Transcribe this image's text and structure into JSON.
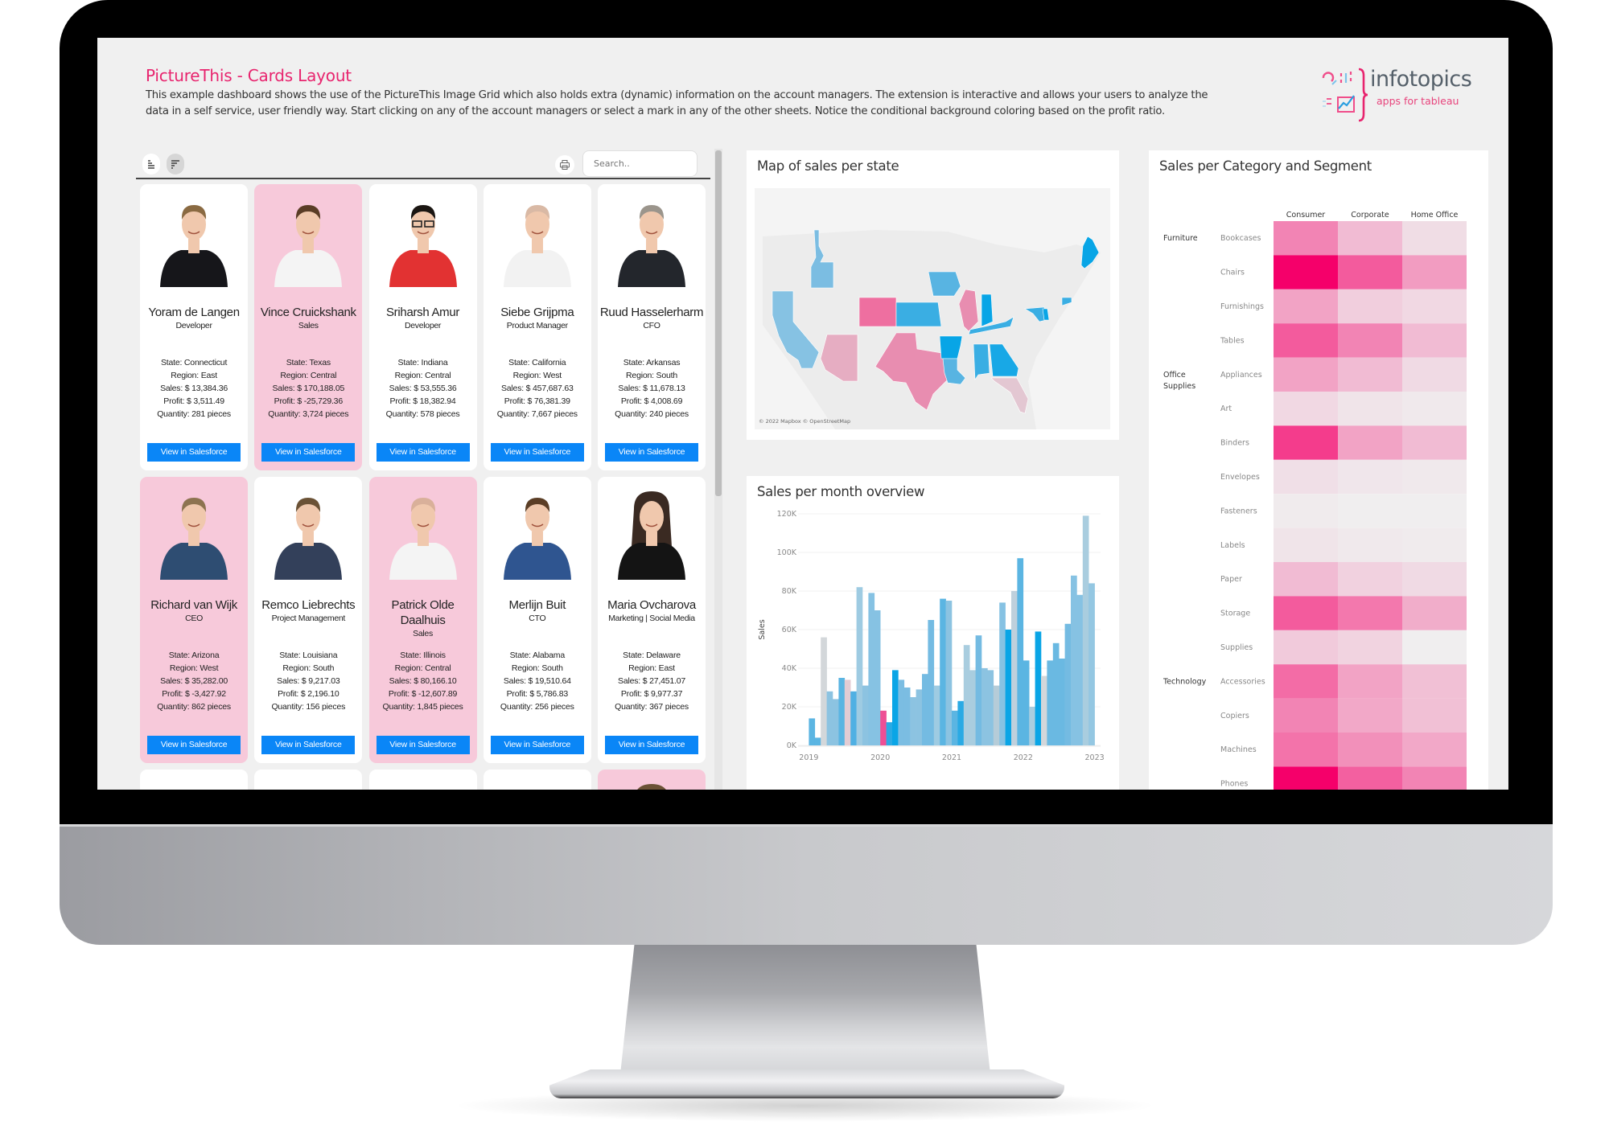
{
  "dashboard": {
    "title": "PictureThis - Cards Layout",
    "description": "This example dashboard shows the use of the PictureThis Image Grid which also holds extra (dynamic) information on the account managers. The extension is interactive and allows your users to analyze the data in a self service, user friendly way. Start clicking on any of the account managers or select a mark in any of the other sheets. Notice the conditional background coloring based on the profit ratio.",
    "accent_color": "#e8246e",
    "logo": {
      "name": "infotopics",
      "tagline": "apps for tableau"
    }
  },
  "image_grid": {
    "toolbar": {
      "sort_asc_icon": "sort-list-icon",
      "sort_desc_icon": "sort-descending-icon",
      "print_icon": "printer-icon",
      "search_placeholder": "Search.."
    },
    "button_label": "View in Salesforce",
    "button_color": "#0a86f7",
    "highlight_color": "#f7c9da",
    "cards": [
      {
        "name": "Yoram de Langen",
        "role": "Developer",
        "state": "State: Connecticut",
        "region": "Region: East",
        "sales": "Sales: $ 13,384.36",
        "profit": "Profit: $ 3,511.49",
        "quantity": "Quantity: 281 pieces",
        "highlight": false,
        "photo": {
          "shirt": "#16161a",
          "hair": "#8a6a42",
          "bg": "none"
        }
      },
      {
        "name": "Vince Cruickshank",
        "role": "Sales",
        "state": "State: Texas",
        "region": "Region: Central",
        "sales": "Sales: $ 170,188.05",
        "profit": "Profit: $ -25,729.36",
        "quantity": "Quantity: 3,724 pieces",
        "highlight": true,
        "photo": {
          "shirt": "#f4f4f4",
          "hair": "#5a3d26"
        }
      },
      {
        "name": "Sriharsh Amur",
        "role": "Developer",
        "state": "State: Indiana",
        "region": "Region: Central",
        "sales": "Sales: $ 53,555.36",
        "profit": "Profit: $ 18,382.94",
        "quantity": "Quantity: 578 pieces",
        "highlight": false,
        "photo": {
          "shirt": "#e23232",
          "hair": "#1b1612"
        }
      },
      {
        "name": "Siebe Grijpma",
        "role": "Product Manager",
        "state": "State: California",
        "region": "Region: West",
        "sales": "Sales: $ 457,687.63",
        "profit": "Profit: $ 76,381.39",
        "quantity": "Quantity: 7,667 pieces",
        "highlight": false,
        "photo": {
          "shirt": "#f2f2f2",
          "hair": "#d9b9a5"
        }
      },
      {
        "name": "Ruud Hasselerharm",
        "role": "CFO",
        "state": "State: Arkansas",
        "region": "Region: South",
        "sales": "Sales: $ 11,678.13",
        "profit": "Profit: $ 4,008.69",
        "quantity": "Quantity: 240 pieces",
        "highlight": false,
        "photo": {
          "shirt": "#23262c",
          "hair": "#9b958c"
        }
      },
      {
        "name": "Richard van Wijk",
        "role": "CEO",
        "state": "State: Arizona",
        "region": "Region: West",
        "sales": "Sales: $ 35,282.00",
        "profit": "Profit: $ -3,427.92",
        "quantity": "Quantity: 862 pieces",
        "highlight": true,
        "photo": {
          "shirt": "#2e4d72",
          "hair": "#8d7350"
        }
      },
      {
        "name": "Remco Liebrechts",
        "role": "Project Management",
        "state": "State: Louisiana",
        "region": "Region: South",
        "sales": "Sales: $ 9,217.03",
        "profit": "Profit: $ 2,196.10",
        "quantity": "Quantity: 156 pieces",
        "highlight": false,
        "photo": {
          "shirt": "#33405a",
          "hair": "#6b5236"
        }
      },
      {
        "name": "Patrick Olde Daalhuis",
        "role": "Sales",
        "state": "State: Illinois",
        "region": "Region: Central",
        "sales": "Sales: $ 80,166.10",
        "profit": "Profit: $ -12,607.89",
        "quantity": "Quantity: 1,845 pieces",
        "highlight": true,
        "photo": {
          "shirt": "#f4f4f4",
          "hair": "#d9b09a"
        }
      },
      {
        "name": "Merlijn Buit",
        "role": "CTO",
        "state": "State: Alabama",
        "region": "Region: South",
        "sales": "Sales: $ 19,510.64",
        "profit": "Profit: $ 5,786.83",
        "quantity": "Quantity: 256 pieces",
        "highlight": false,
        "photo": {
          "shirt": "#2f5590",
          "hair": "#5b3e26"
        }
      },
      {
        "name": "Maria Ovcharova",
        "role": "Marketing | Social Media",
        "state": "State: Delaware",
        "region": "Region: East",
        "sales": "Sales: $ 27,451.07",
        "profit": "Profit: $ 9,977.37",
        "quantity": "Quantity: 367 pieces",
        "highlight": false,
        "photo": {
          "shirt": "#141414",
          "hair": "#3a2a22"
        }
      }
    ],
    "partial_row_highlight": [
      false,
      false,
      false,
      false,
      true
    ]
  },
  "map_sheet": {
    "title": "Map of sales per state",
    "attribution": "© 2022 Mapbox © OpenStreetMap",
    "states": [
      {
        "state": "Idaho",
        "color": "#7bbde2"
      },
      {
        "state": "California",
        "color": "#86c2e3"
      },
      {
        "state": "Arizona",
        "color": "#e6adc2"
      },
      {
        "state": "Colorado",
        "color": "#ee6fa0"
      },
      {
        "state": "Texas",
        "color": "#e88db0"
      },
      {
        "state": "Kansas",
        "color": "#3aaee3"
      },
      {
        "state": "Iowa",
        "color": "#58b4e2"
      },
      {
        "state": "Illinois",
        "color": "#e88db0"
      },
      {
        "state": "Indiana",
        "color": "#08a5e6"
      },
      {
        "state": "Kentucky",
        "color": "#3aaee3"
      },
      {
        "state": "Arkansas",
        "color": "#08a5e6"
      },
      {
        "state": "Louisiana",
        "color": "#58b4e2"
      },
      {
        "state": "Alabama",
        "color": "#3aaee3"
      },
      {
        "state": "Georgia",
        "color": "#18a8e6"
      },
      {
        "state": "Florida",
        "color": "#e3c7d2"
      },
      {
        "state": "Maryland",
        "color": "#3aaee3"
      },
      {
        "state": "Delaware",
        "color": "#08a5e6"
      },
      {
        "state": "Connecticut",
        "color": "#3aaee3"
      },
      {
        "state": "Maine",
        "color": "#08a5e6"
      }
    ]
  },
  "chart_data": [
    {
      "type": "bar",
      "title": "Sales per month overview",
      "xlabel": "",
      "ylabel": "Sales",
      "ylim": [
        0,
        120000
      ],
      "yticks": [
        "0K",
        "20K",
        "40K",
        "60K",
        "80K",
        "100K",
        "120K"
      ],
      "ytick_values": [
        0,
        20000,
        40000,
        60000,
        80000,
        100000,
        120000
      ],
      "xticks": [
        "2019",
        "2020",
        "2021",
        "2022",
        "2023"
      ],
      "grid": true,
      "x_start": "2019-01",
      "values": [
        14000,
        4000,
        56000,
        28000,
        24000,
        35000,
        34000,
        28000,
        82000,
        31000,
        79000,
        70000,
        18000,
        12000,
        39000,
        34000,
        30000,
        25000,
        29000,
        37000,
        65000,
        31000,
        76000,
        75000,
        18000,
        23000,
        52000,
        39000,
        57000,
        40000,
        39000,
        31000,
        74000,
        60000,
        80000,
        97000,
        44000,
        20000,
        59000,
        36000,
        44000,
        53000,
        45000,
        63000,
        88000,
        78000,
        119000,
        84000
      ],
      "colors": [
        "#5bb5e2",
        "#5bb5e2",
        "#d3d7da",
        "#8cc3e1",
        "#8cc3e1",
        "#5bb5e2",
        "#e3ccd3",
        "#4fb0e3",
        "#9ecbe2",
        "#8cc3e1",
        "#86c2e3",
        "#86c2e3",
        "#ee4f95",
        "#2aaae4",
        "#0aa5e6",
        "#7bbde2",
        "#7bbde2",
        "#8cc3e1",
        "#8cc3e1",
        "#74bbe2",
        "#74bbe2",
        "#9ecbe2",
        "#5bb5e2",
        "#8cc3e1",
        "#5bb5e2",
        "#2aaae4",
        "#a9cddf",
        "#a9cddf",
        "#74bbe2",
        "#8cc3e1",
        "#8cc3e1",
        "#b5ccd8",
        "#86c2e3",
        "#0aa5e6",
        "#bfd0dc",
        "#5bb5e2",
        "#5bb5e2",
        "#a9cddf",
        "#0aa5e6",
        "#d3d7da",
        "#6ab9e2",
        "#6ab9e2",
        "#6ab9e2",
        "#74bbe2",
        "#86c2e3",
        "#86c2e3",
        "#a9cddf",
        "#94c7e2"
      ]
    },
    {
      "type": "heatmap",
      "title": "Sales per Category and Segment",
      "columns": [
        "Consumer",
        "Corporate",
        "Home Office"
      ],
      "groups": [
        {
          "category": "Furniture",
          "rows": [
            "Bookcases",
            "Chairs",
            "Furnishings",
            "Tables"
          ]
        },
        {
          "category": "Office Supplies",
          "rows": [
            "Appliances",
            "Art",
            "Binders",
            "Envelopes",
            "Fasteners",
            "Labels",
            "Paper",
            "Storage",
            "Supplies"
          ]
        },
        {
          "category": "Technology",
          "rows": [
            "Accessories",
            "Copiers",
            "Machines",
            "Phones"
          ]
        }
      ],
      "intensity": [
        [
          0.45,
          0.22,
          0.08
        ],
        [
          1.0,
          0.62,
          0.35
        ],
        [
          0.32,
          0.14,
          0.1
        ],
        [
          0.62,
          0.45,
          0.22
        ],
        [
          0.32,
          0.22,
          0.09
        ],
        [
          0.1,
          0.05,
          0.03
        ],
        [
          0.75,
          0.32,
          0.22
        ],
        [
          0.07,
          0.04,
          0.03
        ],
        [
          0.02,
          0.01,
          0.01
        ],
        [
          0.05,
          0.03,
          0.02
        ],
        [
          0.22,
          0.13,
          0.09
        ],
        [
          0.62,
          0.5,
          0.28
        ],
        [
          0.16,
          0.12,
          0.01
        ],
        [
          0.55,
          0.32,
          0.2
        ],
        [
          0.45,
          0.3,
          0.2
        ],
        [
          0.52,
          0.4,
          0.3
        ],
        [
          1.0,
          0.6,
          0.45
        ]
      ],
      "color_min": "#f0f0f0",
      "color_max": "#f5006a"
    }
  ]
}
